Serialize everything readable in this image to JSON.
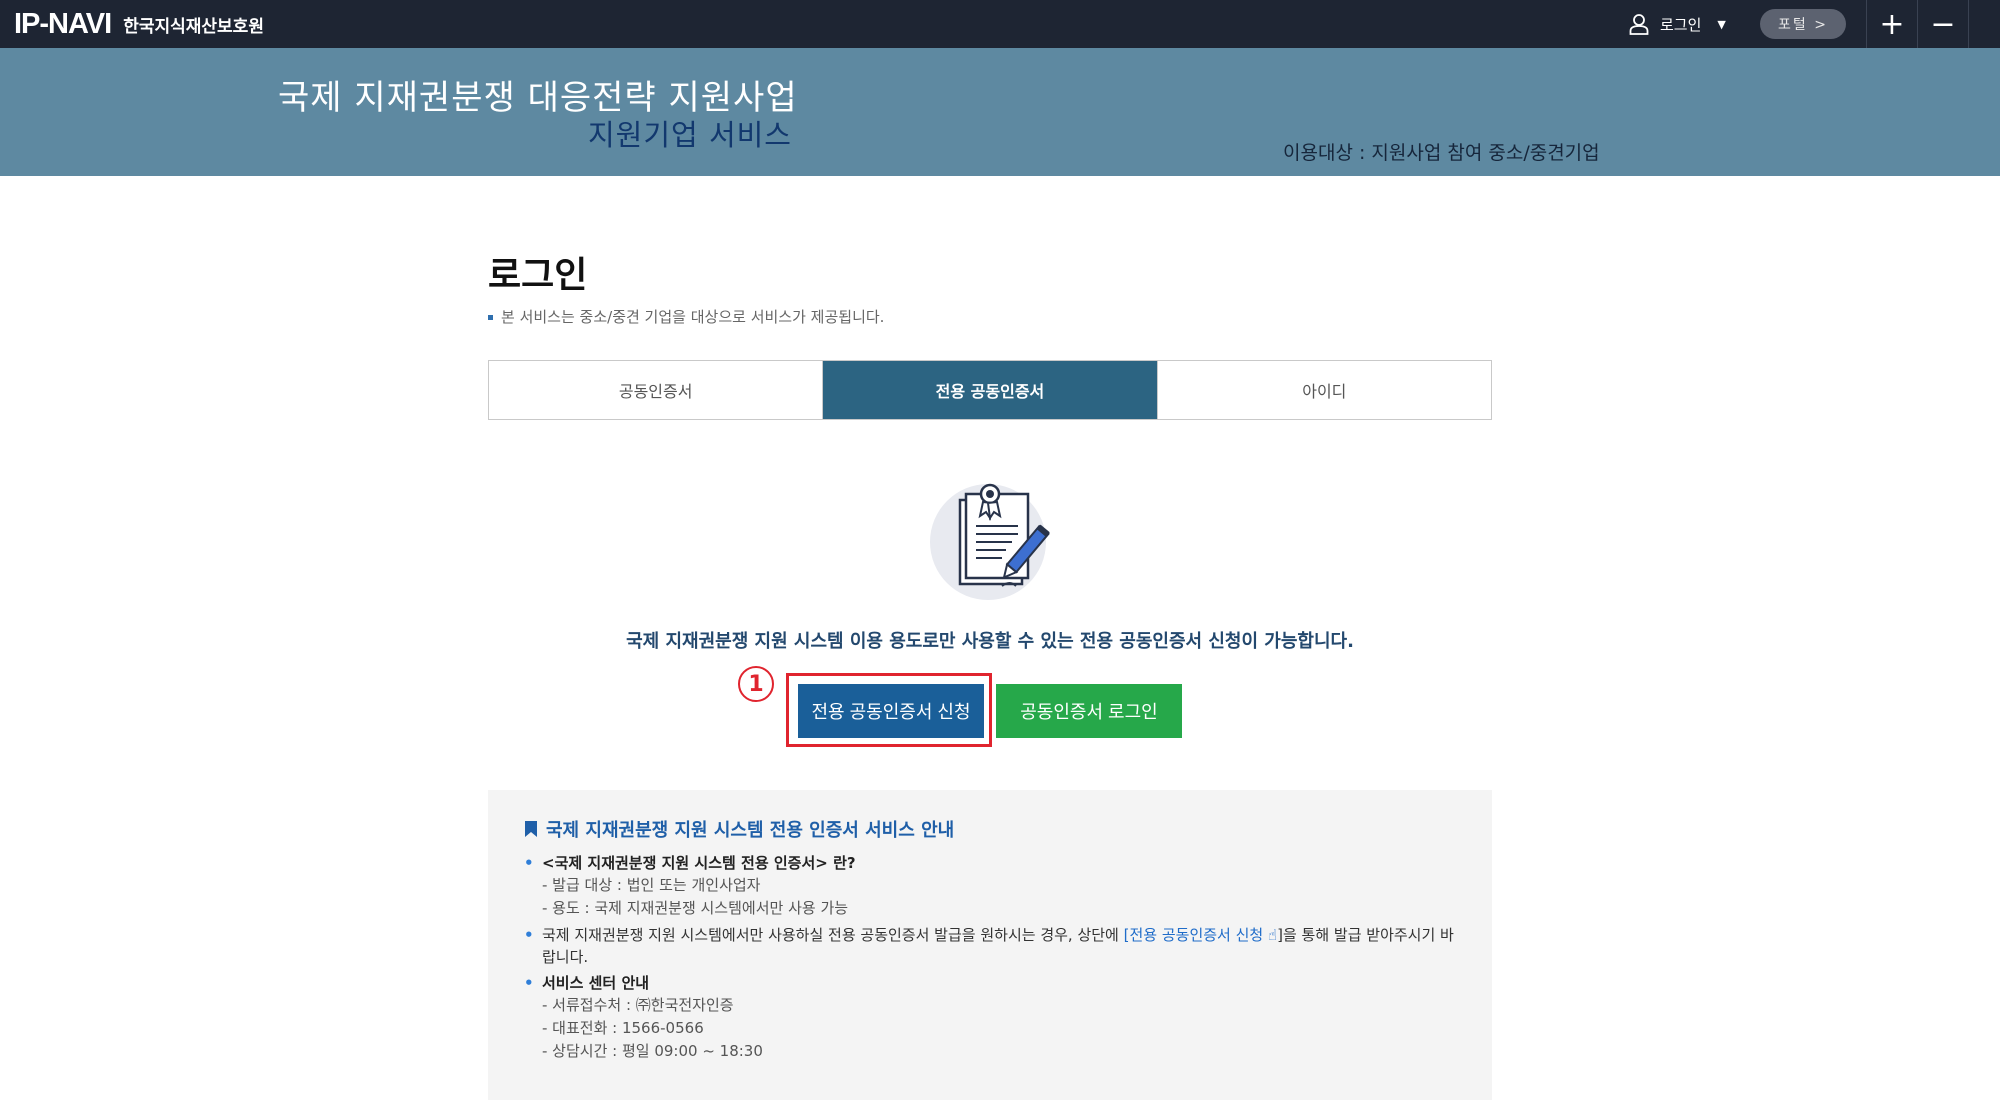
{
  "header": {
    "logo_mark": "IP-NAVI",
    "org_name": "한국지식재산보호원",
    "login_label": "로그인",
    "portal_label": "포털 >",
    "zoom_in": "+",
    "zoom_out": "−"
  },
  "banner": {
    "title": "국제 지재권분쟁 대응전략 지원사업",
    "subtitle": "지원기업 서비스",
    "target": "이용대상 : 지원사업 참여 중소/중견기업"
  },
  "main": {
    "title": "로그인",
    "note": "본 서비스는 중소/중견 기업을 대상으로 서비스가 제공됩니다.",
    "tabs": [
      {
        "label": "공동인증서",
        "active": false
      },
      {
        "label": "전용 공동인증서",
        "active": true
      },
      {
        "label": "아이디",
        "active": false
      }
    ],
    "notice": "국제 지재권분쟁 지원 시스템 이용 용도로만 사용할 수 있는 전용 공동인증서 신청이 가능합니다.",
    "step_number": "1",
    "apply_button": "전용 공동인증서 신청",
    "cert_login_button": "공동인증서 로그인"
  },
  "info": {
    "title": "국제 지재권분쟁 지원 시스템 전용 인증서 서비스 안내",
    "item1": {
      "head": "<국제 지재권분쟁 지원 시스템 전용 인증서> 란?",
      "lines": [
        "- 발급 대상 : 법인 또는 개인사업자",
        "- 용도 : 국제 지재권분쟁 시스템에서만 사용 가능"
      ]
    },
    "item2": {
      "text_before": "국제 지재권분쟁 지원 시스템에서만 사용하실 전용 공동인증서 발급을 원하시는 경우, 상단에 ",
      "link": "[전용 공동인증서 신청 ",
      "hand": "☝",
      "text_after": "]을 통해 발급 받아주시기 바랍니다."
    },
    "item3": {
      "head": "서비스 센터 안내",
      "lines": [
        "- 서류접수처 : ㈜한국전자인증",
        "- 대표전화 : 1566-0566",
        "- 상담시간 : 평일 09:00 ~ 18:30"
      ]
    }
  },
  "colors": {
    "topbar": "#1e2533",
    "banner": "#5e89a1",
    "tab_active": "#2c6482",
    "apply_button": "#1a5f99",
    "login_button": "#26a84a",
    "highlight": "#e0242e"
  },
  "icons": {
    "user": "user-icon",
    "caret": "caret-down-icon",
    "certificate": "certificate-document-icon",
    "bookmark": "bookmark-icon"
  }
}
